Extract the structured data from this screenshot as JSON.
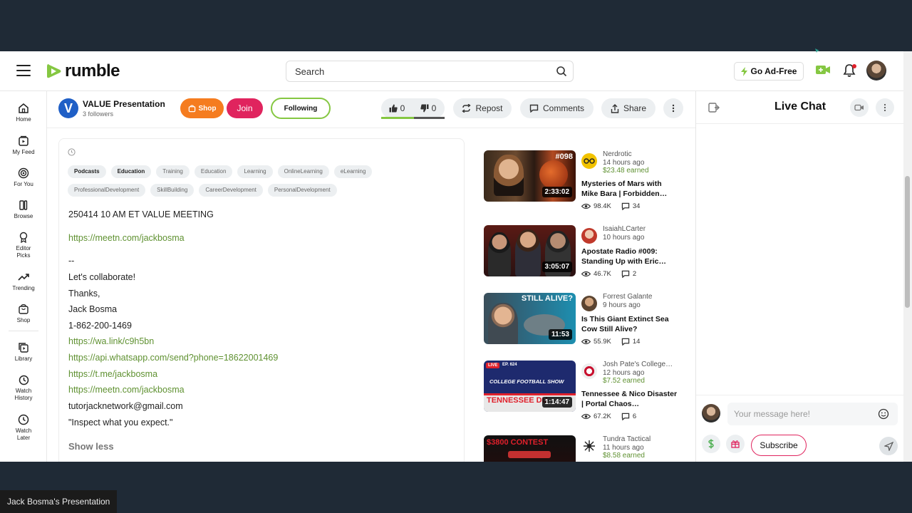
{
  "header": {
    "logo_text": "rumble",
    "search_placeholder": "Search",
    "go_ad_free": "Go Ad-Free"
  },
  "sidebar": {
    "items": [
      {
        "label": "Home",
        "icon": "home-icon"
      },
      {
        "label": "My Feed",
        "icon": "feed-icon"
      },
      {
        "label": "For You",
        "icon": "target-icon"
      },
      {
        "label": "Browse",
        "icon": "browse-icon"
      },
      {
        "label": "Editor Picks",
        "icon": "ribbon-icon"
      },
      {
        "label": "Trending",
        "icon": "trending-icon"
      },
      {
        "label": "Shop",
        "icon": "shop-icon"
      },
      {
        "label": "Library",
        "icon": "library-icon"
      },
      {
        "label": "Watch History",
        "icon": "history-icon"
      },
      {
        "label": "Watch Later",
        "icon": "clock-icon"
      }
    ]
  },
  "channel": {
    "avatar_letter": "V",
    "name": "VALUE Presentation",
    "followers": "3 followers",
    "shop": "Shop",
    "join": "Join",
    "following": "Following",
    "likes": "0",
    "dislikes": "0",
    "repost": "Repost",
    "comments": "Comments",
    "share": "Share"
  },
  "description": {
    "tags": [
      "Podcasts",
      "Education",
      "Training",
      "Education",
      "Learning",
      "OnlineLearning",
      "eLearning",
      "ProfessionalDevelopment",
      "SkillBuilding",
      "CareerDevelopment",
      "PersonalDevelopment"
    ],
    "title_line": "250414 10 AM ET VALUE MEETING",
    "link1": "https://meetn.com/jackbosma",
    "dash": "--",
    "collab": "Let's collaborate!",
    "thanks": "Thanks,",
    "name": "Jack Bosma",
    "phone": "1-862-200-1469",
    "wa_link": "https://wa.link/c9h5bn",
    "whatsapp_link": "https://api.whatsapp.com/send?phone=18622001469",
    "tme_link": "https://t.me/jackbosma",
    "link2": "https://meetn.com/jackbosma",
    "email": "tutorjacknetwork@gmail.com",
    "quote": "\"Inspect what you expect.\"",
    "show_less": "Show less"
  },
  "recommended": [
    {
      "channel": "Nerdrotic",
      "ago": "14 hours ago",
      "earned": "$23.48 earned",
      "title": "Mysteries of Mars with Mike Bara | Forbidden…",
      "views": "98.4K",
      "comments": "34",
      "duration": "2:33:02",
      "badge": "#098"
    },
    {
      "channel": "IsaiahLCarter",
      "ago": "10 hours ago",
      "earned": "",
      "title": "Apostate Radio #009: Standing Up with Eric…",
      "views": "46.7K",
      "comments": "2",
      "duration": "3:05:07"
    },
    {
      "channel": "Forrest Galante",
      "ago": "9 hours ago",
      "earned": "",
      "title": "Is This Giant Extinct Sea Cow Still Alive?",
      "views": "55.9K",
      "comments": "14",
      "duration": "11:53",
      "badge": "STILL ALIVE?"
    },
    {
      "channel": "Josh Pate's College…",
      "ago": "12 hours ago",
      "earned": "$7.52 earned",
      "title": "Tennessee & Nico Disaster | Portal Chaos…",
      "views": "67.2K",
      "comments": "6",
      "duration": "1:14:47",
      "badge_live": "LIVE",
      "badge_ep": "EP. 624",
      "show_name": "COLLEGE FOOTBALL SHOW",
      "banner": "TENNESSEE DU"
    },
    {
      "channel": "Tundra Tactical",
      "ago": "11 hours ago",
      "earned": "$8.58 earned",
      "title": "",
      "views": "",
      "comments": "",
      "duration": "",
      "badge": "$3800 CONTEST"
    }
  ],
  "chat": {
    "title": "Live Chat",
    "placeholder": "Your message here!",
    "subscribe": "Subscribe"
  },
  "caption": "Jack Bosma's Presentation",
  "colors": {
    "brand_green": "#85c742",
    "shop_orange": "#f57c1f",
    "join_red": "#e0245e",
    "link_green": "#5f9131",
    "frame_bg": "#1f2a36"
  }
}
